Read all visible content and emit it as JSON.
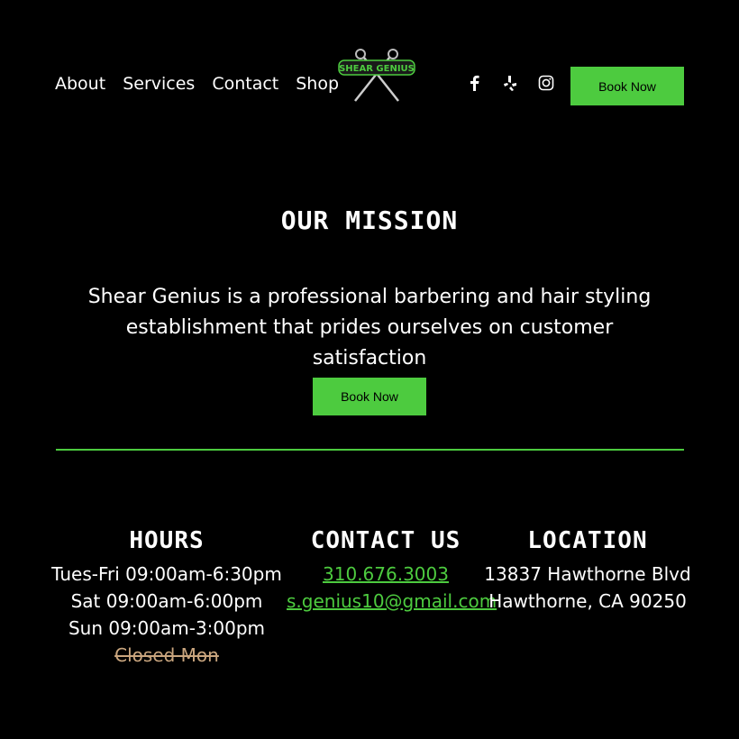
{
  "nav": {
    "items": [
      "About",
      "Services",
      "Contact",
      "Shop"
    ]
  },
  "logo": {
    "text": "SHEAR GENIUS",
    "icon": "scissors-icon"
  },
  "social": {
    "icons": [
      "facebook-icon",
      "yelp-icon",
      "instagram-icon"
    ]
  },
  "header": {
    "book_label": "Book Now"
  },
  "mission": {
    "title": "OUR MISSION",
    "text": "Shear Genius is a professional barbering and hair styling establishment that prides ourselves on customer satisfaction",
    "book_label": "Book Now"
  },
  "hours": {
    "title": "HOURS",
    "lines": [
      "Tues-Fri 09:00am-6:30pm",
      "Sat 09:00am-6:00pm",
      "Sun 09:00am-3:00pm"
    ],
    "closed": "Closed Mon"
  },
  "contact": {
    "title": "CONTACT US",
    "phone": "310.676.3003",
    "email": "s.genius10@gmail.com"
  },
  "location": {
    "title": "LOCATION",
    "line1": "13837 Hawthorne Blvd",
    "line2": "Hawthorne, CA 90250"
  },
  "colors": {
    "accent": "#4dcb3f",
    "background": "#000000",
    "closed": "#c9a57e"
  }
}
